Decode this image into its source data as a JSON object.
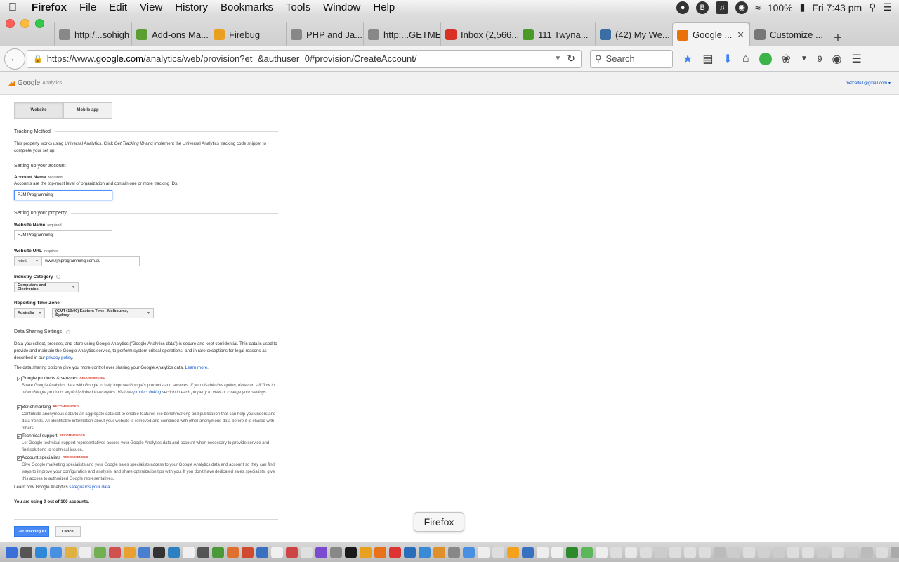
{
  "menubar": {
    "app": "Firefox",
    "items": [
      "File",
      "Edit",
      "View",
      "History",
      "Bookmarks",
      "Tools",
      "Window",
      "Help"
    ],
    "battery": "100%",
    "clock": "Fri 7:43 pm"
  },
  "tabs": [
    {
      "label": "http:/...sohigh",
      "color": "#888888"
    },
    {
      "label": "Add-ons Ma...",
      "color": "#5c9e31"
    },
    {
      "label": "Firebug",
      "color": "#e9a020"
    },
    {
      "label": "PHP and Ja...",
      "color": "#888888"
    },
    {
      "label": "http:...GETME",
      "color": "#888888"
    },
    {
      "label": "Inbox (2,566...",
      "color": "#d93025"
    },
    {
      "label": "111 Twyna...",
      "color": "#4a9a2a"
    },
    {
      "label": "(42) My We...",
      "color": "#3a6ea5"
    },
    {
      "label": "Google ...",
      "color": "#e8710a"
    },
    {
      "label": "Customize ...",
      "color": "#777777"
    }
  ],
  "active_tab_index": 8,
  "nav": {
    "url_prefix": "https://www.",
    "url_domain": "google.com",
    "url_rest": "/analytics/web/provision?et=&authuser=0#provision/CreateAccount/",
    "search_placeholder": "Search",
    "badge_count": "9"
  },
  "ga": {
    "logo_google": "Google",
    "logo_analytics": "Analytics",
    "user_email": "metcalfe1@gmail.com"
  },
  "form": {
    "seg_website": "Website",
    "seg_mobile": "Mobile app",
    "tracking_heading": "Tracking Method",
    "tracking_text_a": "This property works using Universal Analytics. Click ",
    "tracking_text_em": "Get Tracking ID",
    "tracking_text_b": " and implement the Universal Analytics tracking code snippet to complete your set up.",
    "account_heading": "Setting up your account",
    "account_name_label": "Account Name",
    "required": "required",
    "account_name_help": "Accounts are the top-most level of organization and contain one or more tracking IDs.",
    "account_name_value": "RJM Programming",
    "property_heading": "Setting up your property",
    "website_name_label": "Website Name",
    "website_name_value": "RJM Programming",
    "website_url_label": "Website URL",
    "url_protocol": "http://",
    "website_url_value": "www.rjmprogramming.com.au",
    "industry_label": "Industry Category",
    "industry_value": "Computers and Electronics",
    "timezone_label": "Reporting Time Zone",
    "country_value": "Australia",
    "timezone_value": "(GMT+10:00) Eastern Time - Melbourne, Sydney",
    "sharing_heading": "Data Sharing Settings",
    "sharing_text_a": "Data you collect, process, and store using Google Analytics (\"Google Analytics data\") is secure and kept confidential. This data is used to provide and maintain the Google Analytics service, to perform system critical operations, and in rare exceptions for legal reasons as described in our ",
    "privacy_link": "privacy policy",
    "sharing_text_b": ".",
    "control_text": "The data sharing options give you more control over sharing your Google Analytics data. ",
    "learn_more": "Learn more.",
    "recommended": "RECOMMENDED",
    "options": [
      {
        "title": "Google products & services",
        "desc_a": "Share Google Analytics data with Google to help improve Google's products and services. ",
        "desc_em_a": "If you disable this option, data can still flow to other Google products explicitly linked to Analytics. Visit the ",
        "desc_link": "product linking",
        "desc_em_b": " section in each property to view or change your settings."
      },
      {
        "title": "Benchmarking",
        "desc_a": "Contribute anonymous data to an aggregate data set to enable features like benchmarking and publication that can help you understand data trends. All identifiable information about your website is removed and combined with other anonymous data before it is shared with others."
      },
      {
        "title": "Technical support",
        "desc_a": "Let Google technical support representatives access your Google Analytics data and account when necessary to provide service and find solutions to technical issues."
      },
      {
        "title": "Account specialists",
        "desc_a": "Give Google marketing specialists and your Google sales specialists access to your Google Analytics data and account so they can find ways to improve your configuration and analysis, and share optimization tips with you. If you don't have dedicated sales specialists, give this access to authorized Google representatives."
      }
    ],
    "safeguards_a": "Learn how Google Analytics ",
    "safeguards_link": "safeguards your data",
    "safeguards_b": ".",
    "usage": "You are using 0 out of 100 accounts.",
    "get_tracking": "Get Tracking ID",
    "cancel": "Cancel"
  },
  "tooltip": "Firefox"
}
